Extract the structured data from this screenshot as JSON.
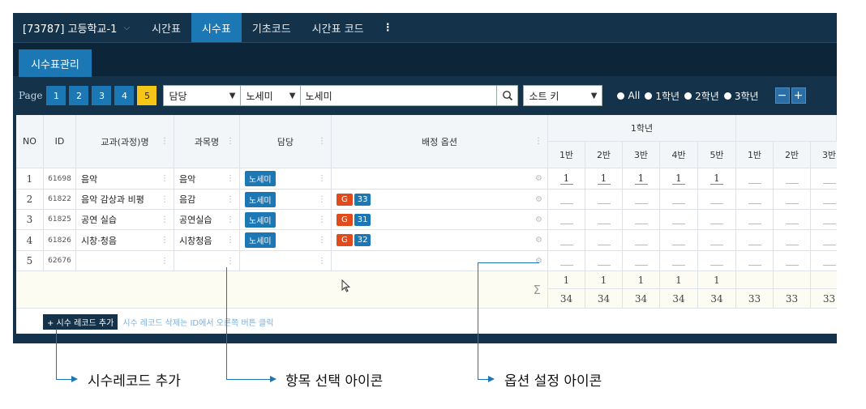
{
  "topbar": {
    "school": "[73787] 고등학교-1",
    "nav": [
      "시간표",
      "시수표",
      "기초코드",
      "시간표 코드"
    ]
  },
  "subtab": "시수표관리",
  "toolbar": {
    "page_label": "Page",
    "pages": [
      "1",
      "2",
      "3",
      "4",
      "5"
    ],
    "active_page": "5",
    "filter_select": "담당",
    "teacher_select": "노세미",
    "search_value": "노세미",
    "sort_select": "소트 키",
    "radios": [
      "All",
      "1학년",
      "2학년",
      "3학년"
    ],
    "minus": "−",
    "plus": "+"
  },
  "grid": {
    "headers": {
      "no": "NO",
      "id": "ID",
      "course": "교과(과정)명",
      "subject": "과목명",
      "teacher": "담당",
      "option": "배정 옵션"
    },
    "grade_headers": [
      "1학년"
    ],
    "class_headers": [
      "1반",
      "2반",
      "3반",
      "4반",
      "5반",
      "1반",
      "2반",
      "3반"
    ],
    "rows": [
      {
        "no": "1",
        "id": "61698",
        "course": "음악",
        "subject": "음악",
        "teacher": "노세미",
        "g": "",
        "n": "",
        "vals": [
          "1",
          "1",
          "1",
          "1",
          "1"
        ]
      },
      {
        "no": "2",
        "id": "61822",
        "course": "음악 감상과 비평",
        "subject": "음감",
        "teacher": "노세미",
        "g": "G",
        "n": "33",
        "vals": []
      },
      {
        "no": "3",
        "id": "61825",
        "course": "공연 실습",
        "subject": "공연실습",
        "teacher": "노세미",
        "g": "G",
        "n": "31",
        "vals": []
      },
      {
        "no": "4",
        "id": "61826",
        "course": "시창·청음",
        "subject": "시창청음",
        "teacher": "노세미",
        "g": "G",
        "n": "32",
        "vals": []
      },
      {
        "no": "5",
        "id": "62676",
        "course": "",
        "subject": "",
        "teacher": "",
        "g": "",
        "n": "",
        "vals": []
      }
    ],
    "sum_symbol": "Σ",
    "sum_row1": [
      "1",
      "1",
      "1",
      "1",
      "1"
    ],
    "sum_row2": [
      "34",
      "34",
      "34",
      "34",
      "34",
      "33",
      "33",
      "33"
    ]
  },
  "add_button": "+ 시수 레코드 추가",
  "hint": "시수 레코드 삭제는 ID에서 오른쪽 버튼 클릭",
  "annotations": [
    "시수레코드 추가",
    "항목 선택 아이콘",
    "옵션 설정 아이콘"
  ]
}
